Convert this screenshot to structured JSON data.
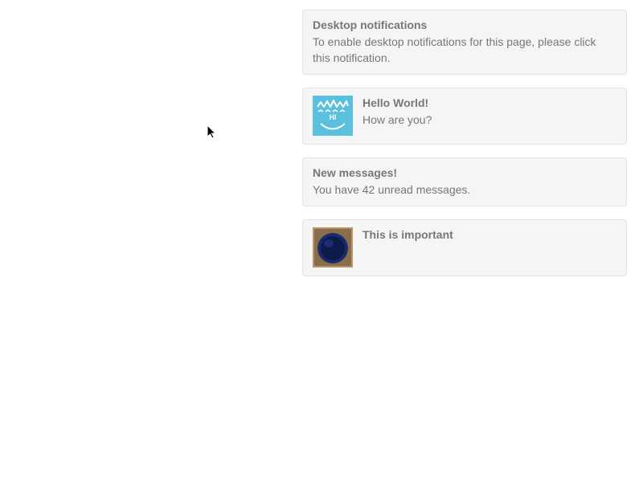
{
  "notifications": [
    {
      "title": "Desktop notifications",
      "body": "To enable desktop notifications for this page, please click this notification.",
      "has_icon": false
    },
    {
      "title": "Hello World!",
      "body": "How are you?",
      "has_icon": true,
      "icon": "avatar-blue-smile"
    },
    {
      "title": "New messages!",
      "body": "You have 42 unread messages.",
      "has_icon": false
    },
    {
      "title": "This is important",
      "body": "",
      "has_icon": true,
      "icon": "photo-blue-circle"
    }
  ]
}
